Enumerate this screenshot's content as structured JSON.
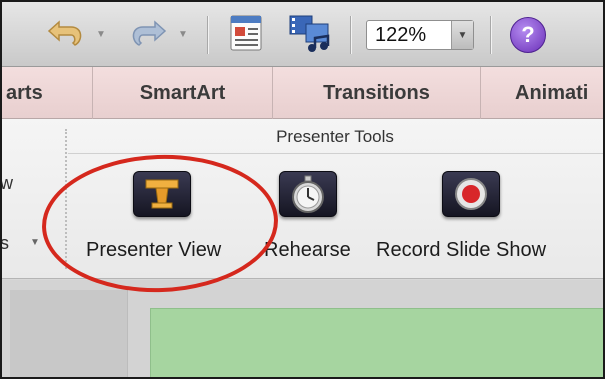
{
  "toolbar": {
    "zoom_value": "122%",
    "help_glyph": "?",
    "icons": [
      "undo-icon",
      "redo-icon",
      "media-browser-icon",
      "movie-audio-icon",
      "help-icon"
    ]
  },
  "tabs": {
    "partial_left": "arts",
    "smartart": "SmartArt",
    "transitions": "Transitions",
    "animations_partial": "Animati"
  },
  "ribbon": {
    "group_title": "Presenter Tools",
    "left_partial_1": "w",
    "left_partial_2": "s",
    "tools": {
      "presenter_view": "Presenter View",
      "rehearse": "Rehearse",
      "record_slide_show": "Record Slide Show"
    }
  },
  "colors": {
    "highlight_circle": "#d5281d",
    "tab_background": "#f3dede",
    "slide_green": "#a6d5a0",
    "help_purple": "#6a2fb8"
  }
}
